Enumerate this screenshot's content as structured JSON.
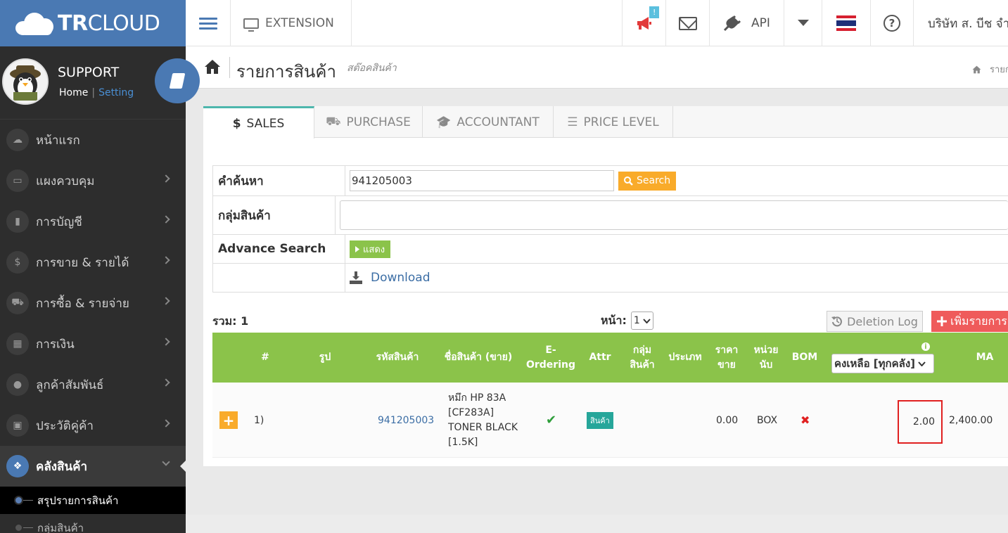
{
  "brand": {
    "name_bold": "TR",
    "name_light": "CLOUD"
  },
  "topbar": {
    "extension_label": "EXTENSION",
    "notification_count": "!",
    "api_label": "API",
    "company_name": "บริษัท ส. บีช จำ"
  },
  "sidebar": {
    "user_name": "SUPPORT",
    "home_link": "Home",
    "separator": "|",
    "setting_link": "Setting",
    "items": [
      {
        "label": "หน้าแรก",
        "icon": "cloud-icon",
        "glyph": "☁"
      },
      {
        "label": "แผงควบคุม",
        "icon": "monitor-icon",
        "glyph": "▭"
      },
      {
        "label": "การบัญชี",
        "icon": "book-icon",
        "glyph": "▮"
      },
      {
        "label": "การขาย & รายได้",
        "icon": "dollar-icon",
        "glyph": "$"
      },
      {
        "label": "การซื้อ & รายจ่าย",
        "icon": "cart-icon",
        "glyph": "⛟"
      },
      {
        "label": "การเงิน",
        "icon": "calendar-icon",
        "glyph": "▦"
      },
      {
        "label": "ลูกค้าสัมพันธ์",
        "icon": "users-icon",
        "glyph": "●"
      },
      {
        "label": "ประวัติคู่ค้า",
        "icon": "address-book-icon",
        "glyph": "▣"
      },
      {
        "label": "คลังสินค้า",
        "icon": "cubes-icon",
        "glyph": "❖"
      }
    ],
    "sub_items": [
      "สรุปรายการสินค้า",
      "กลุ่มสินค้า"
    ]
  },
  "page": {
    "title": "รายการสินค้า",
    "subtitle": "สต๊อคสินค้า",
    "breadcrumb": "รายการ"
  },
  "tabs": [
    {
      "label": "SALES",
      "icon": "$"
    },
    {
      "label": "PURCHASE",
      "icon": "⛟"
    },
    {
      "label": "ACCOUNTANT",
      "icon": "🎓"
    },
    {
      "label": "PRICE LEVEL",
      "icon": "☰"
    }
  ],
  "search_form": {
    "search_label": "คำค้นหา",
    "search_value": "941205003",
    "search_button": "Search",
    "group_label": "กลุ่มสินค้า",
    "group_value": "",
    "advance_label": "Advance Search",
    "show_button": "แสดง",
    "download_label": "Download"
  },
  "list": {
    "total_label": "รวม: 1",
    "page_label": "หน้า:",
    "page_value": "1",
    "deletion_log": "Deletion Log",
    "add_button": "เพิ่มรายการ"
  },
  "table": {
    "headers": {
      "index": "#",
      "image": "รูป",
      "code": "รหัสสินค้า",
      "name": "ชื่อสินค้า (ขาย)",
      "eordering": "E-Ordering",
      "attr": "Attr",
      "group": "กลุ่มสินค้า",
      "type": "ประเภท",
      "price": "ราคาขาย",
      "unit": "หน่วยนับ",
      "bom": "BOM",
      "stock_select": "คงเหลือ [ทุกคลัง]",
      "ma": "MA"
    },
    "rows": [
      {
        "index": "1)",
        "code": "941205003",
        "name": "หมึก HP 83A [CF283A] TONER BLACK [1.5K]",
        "eordering": "✔",
        "attr": "สินค้า",
        "price": "0.00",
        "unit": "BOX",
        "bom": "✖",
        "stock": "2.00",
        "ma": "2,400.00"
      }
    ]
  },
  "colors": {
    "brand_blue": "#4a79b3",
    "sidebar_bg": "#2d2d2d",
    "table_header_green": "#8bc34a",
    "search_orange": "#f9ab2a",
    "add_red": "#ef5b5b",
    "highlight_red": "#e02020"
  }
}
